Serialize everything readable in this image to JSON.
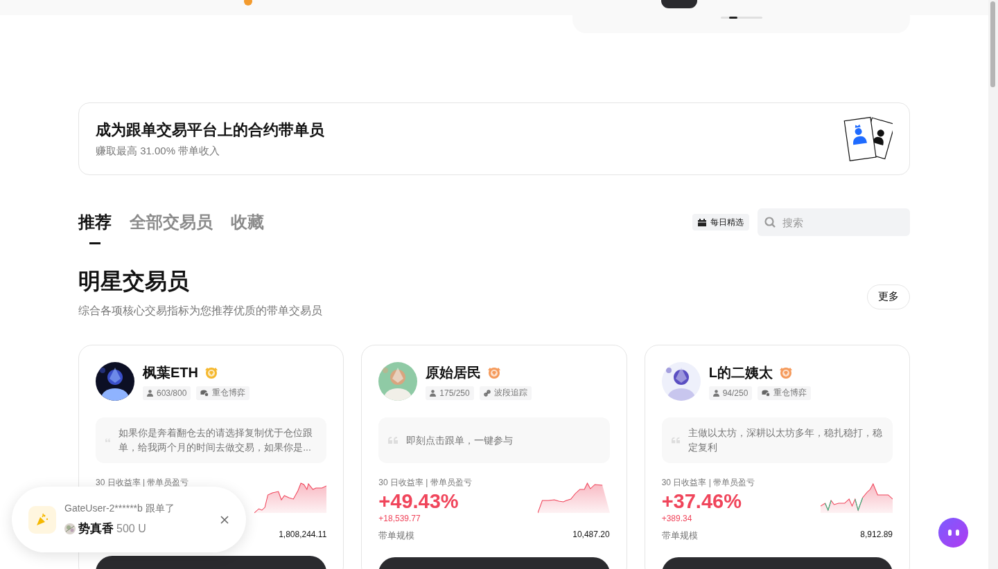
{
  "promo": {
    "title": "成为跟单交易平台上的合约带单员",
    "subtitle": "赚取最高 31.00% 带单收入"
  },
  "tabs": [
    {
      "label": "推荐",
      "selected": true
    },
    {
      "label": "全部交易员",
      "selected": false
    },
    {
      "label": "收藏",
      "selected": false
    }
  ],
  "daily_pick": {
    "label": "每日精选"
  },
  "search": {
    "placeholder": "搜索"
  },
  "section": {
    "title": "明星交易员",
    "subtitle": "综合各项核心交易指标为您推荐优质的带单交易员",
    "more": "更多"
  },
  "traders": [
    {
      "name": "枫葉ETH",
      "color": "#f5b82e",
      "followers": "603/800",
      "style": {
        "kind": "coins",
        "label": "重仓博弈"
      },
      "quote": "如果你是奔着翻仓去的请选择复制优于仓位跟单，给我两个月的时间去做交易，如果你是...",
      "stats_label": "30 日收益率 | 带单员盈亏",
      "scale_value": "1,808,244.11"
    },
    {
      "name": "原始居民",
      "color": "#f59a5b",
      "followers": "175/250",
      "style": {
        "kind": "link",
        "label": "波段追踪"
      },
      "quote": "即刻点击跟单，一键参与",
      "stats_label": "30 日收益率 | 带单员盈亏",
      "roi": "+49.43%",
      "pnl": "+18,539.77",
      "scale_label": "带单规模",
      "scale_value": "10,487.20"
    },
    {
      "name": "L的二姨太",
      "color": "#f59a5b",
      "followers": "94/250",
      "style": {
        "kind": "coins",
        "label": "重仓博弈"
      },
      "quote": "主做以太坊，深耕以太坊多年，稳扎稳打，稳定复利",
      "stats_label": "30 日收益率 | 带单员盈亏",
      "roi": "+37.46%",
      "pnl": "+389.34",
      "scale_label": "带单规模",
      "scale_value": "8,912.89"
    }
  ],
  "toast": {
    "line": "GateUser-2******b 跟单了",
    "trader": "势真香",
    "amount": "500 U"
  }
}
